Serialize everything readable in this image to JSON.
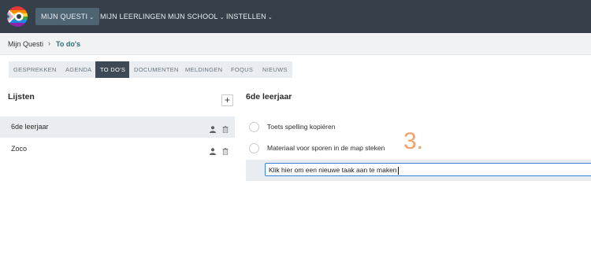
{
  "nav": {
    "logo_icon": "rainbow-logo-icon",
    "items": [
      {
        "label": "MIJN QUESTI",
        "has_chevron": true
      },
      {
        "label": "MIJN LEERLINGEN",
        "has_chevron": false
      },
      {
        "label": "MIJN SCHOOL",
        "has_chevron": true
      },
      {
        "label": "INSTELLEN",
        "has_chevron": true
      }
    ],
    "chevron": "⌄"
  },
  "breadcrumb": {
    "root": "Mijn Questi",
    "separator": "›",
    "current": "To do's"
  },
  "tabs": [
    {
      "label": "GESPREKKEN"
    },
    {
      "label": "AGENDA"
    },
    {
      "label": "TO DO'S"
    },
    {
      "label": "DOCUMENTEN"
    },
    {
      "label": "MELDINGEN"
    },
    {
      "label": "FOQUS"
    },
    {
      "label": "NIEUWS"
    }
  ],
  "lists_panel": {
    "title": "Lijsten",
    "add_label": "+",
    "items": [
      {
        "label": "6de leerjaar"
      },
      {
        "label": "Zoco"
      }
    ]
  },
  "todo_panel": {
    "title": "6de leerjaar",
    "items": [
      {
        "label": "Toets spelling kopiëren"
      },
      {
        "label": "Materiaal voor sporen in de map steken"
      }
    ],
    "new_task_value": "Klik hier om een nieuwe taak aan te maken"
  },
  "annotation": {
    "step_number": "3."
  },
  "colors": {
    "topbar": "#35404a",
    "active_tab": "#3d4a55",
    "accent_link": "#2e6f74",
    "input_border": "#3a82d9",
    "annotation": "#f0a16c"
  }
}
